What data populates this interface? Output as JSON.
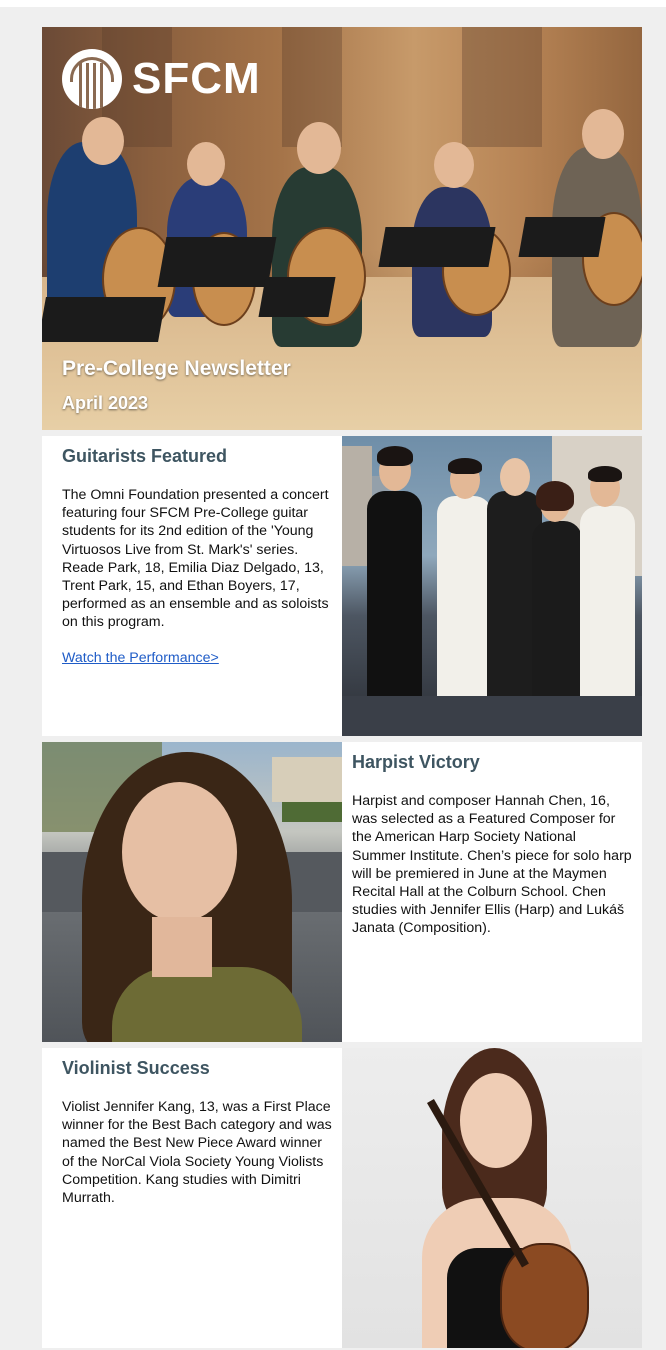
{
  "header": {
    "logo_text": "SFCM",
    "title": "Pre-College Newsletter",
    "date": "April 2023"
  },
  "sections": [
    {
      "heading": "Guitarists Featured",
      "body": "The Omni Foundation presented a concert featuring four SFCM Pre-College guitar students for its 2nd edition of the 'Young Virtuosos Live from St. Mark's' series. Reade Park, 18, Emilia Diaz Delgado, 13, Trent Park, 15, and Ethan Boyers, 17, performed as an ensemble and as soloists on this program.",
      "link": "Watch the Performance>"
    },
    {
      "heading": "Harpist Victory",
      "body": "Harpist and composer Hannah Chen, 16, was selected as a Featured Composer for the American Harp Society National Summer Institute. Chen’s piece for solo harp will be premiered in June at the Maymen Recital Hall at the Colburn School. Chen studies with Jennifer Ellis (Harp) and Lukáš Janata (Composition)."
    },
    {
      "heading": "Violinist Success",
      "body": "Violist Jennifer Kang, 13, was a First Place winner for the Best Bach category and was named the Best New Piece Award winner of the NorCal Viola Society Young Violists Competition. Kang studies with Dimitri Murrath."
    }
  ],
  "colors": {
    "heading": "#3e5561",
    "link": "#1f5cc7",
    "page_bg": "#efefef"
  },
  "icons": {
    "logo": "sfcm-logo-icon"
  }
}
